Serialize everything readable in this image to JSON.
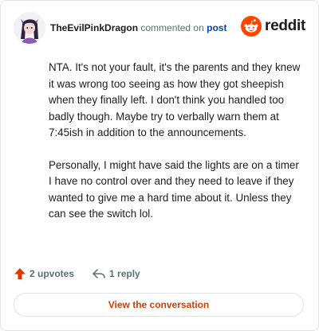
{
  "comment": {
    "author": "TheEvilPinkDragon",
    "action_text": "commented on",
    "post_link": "post",
    "paragraphs": [
      "NTA. It's not your fault, it's the parents and they knew it was wrong too seeing as how they got sheepish when they finally left. I don't think you handled too badly though. Maybe try to verbally warn them at 7:45ish in addition to the announcements.",
      "Personally, I might have said the lights are on a timer I have no control over and they need to leave if they wanted to give me a hard time about it. Unless they can see the switch lol."
    ]
  },
  "brand": {
    "name": "reddit",
    "accent": "#ff4500"
  },
  "actions": {
    "upvotes": "2 upvotes",
    "replies": "1 reply"
  },
  "cta": {
    "label": "View the conversation"
  },
  "colors": {
    "cta_text": "#d93a00",
    "upvote_icon": "#d93a00",
    "post_link": "#0045ac",
    "meta_text": "#576f76"
  },
  "icons": {
    "upvote": "arrow-up-icon",
    "reply": "reply-arrow-icon",
    "avatar": "user-avatar",
    "brand": "reddit-snoo-icon"
  }
}
